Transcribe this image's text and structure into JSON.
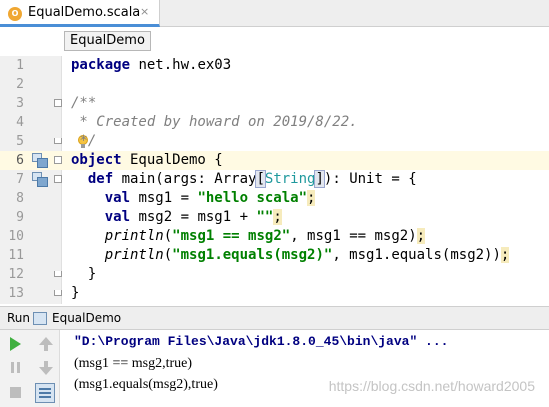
{
  "editor_tab": {
    "label": "EqualDemo.scala",
    "icon": "scala-file-icon",
    "close": "×",
    "icon_text": "O"
  },
  "breadcrumb": {
    "label": "EqualDemo"
  },
  "code": {
    "line_numbers": [
      "1",
      "2",
      "3",
      "4",
      "5",
      "6",
      "7",
      "8",
      "9",
      "10",
      "11",
      "12",
      "13"
    ],
    "l1_kw": "package",
    "l1_rest": " net.hw.ex03",
    "l3": "/**",
    "l4": " * Created by howard on 2019/8/22.",
    "l5": " */",
    "l6_kw": "object",
    "l6_name": " EqualDemo ",
    "l6_brace": "{",
    "l7_kw": "def",
    "l7_a": " main(args: Array",
    "l7_lb": "[",
    "l7_type": "String",
    "l7_rb": "]",
    "l7_b": "): Unit = {",
    "l8_kw": "val",
    "l8_a": " msg1 = ",
    "l8_str": "\"hello scala\"",
    "l8_semi": ";",
    "l9_kw": "val",
    "l9_a": " msg2 = msg1 + ",
    "l9_str": "\"\"",
    "l9_semi": ";",
    "l10_fn": "println",
    "l10_a": "(",
    "l10_str": "\"msg1 == msg2\"",
    "l10_b": ", msg1 == msg2)",
    "l10_semi": ";",
    "l11_fn": "println",
    "l11_a": "(",
    "l11_str": "\"msg1.equals(msg2)\"",
    "l11_b": ", msg1.equals(msg2))",
    "l11_semi": ";",
    "l12": "  }",
    "l13": "}"
  },
  "run_panel": {
    "title": "Run",
    "config": "EqualDemo",
    "output": [
      "\"D:\\Program Files\\Java\\jdk1.8.0_45\\bin\\java\" ...",
      "(msg1 == msg2,true)",
      "(msg1.equals(msg2),true)"
    ],
    "watermark": "https://blog.csdn.net/howard2005"
  }
}
